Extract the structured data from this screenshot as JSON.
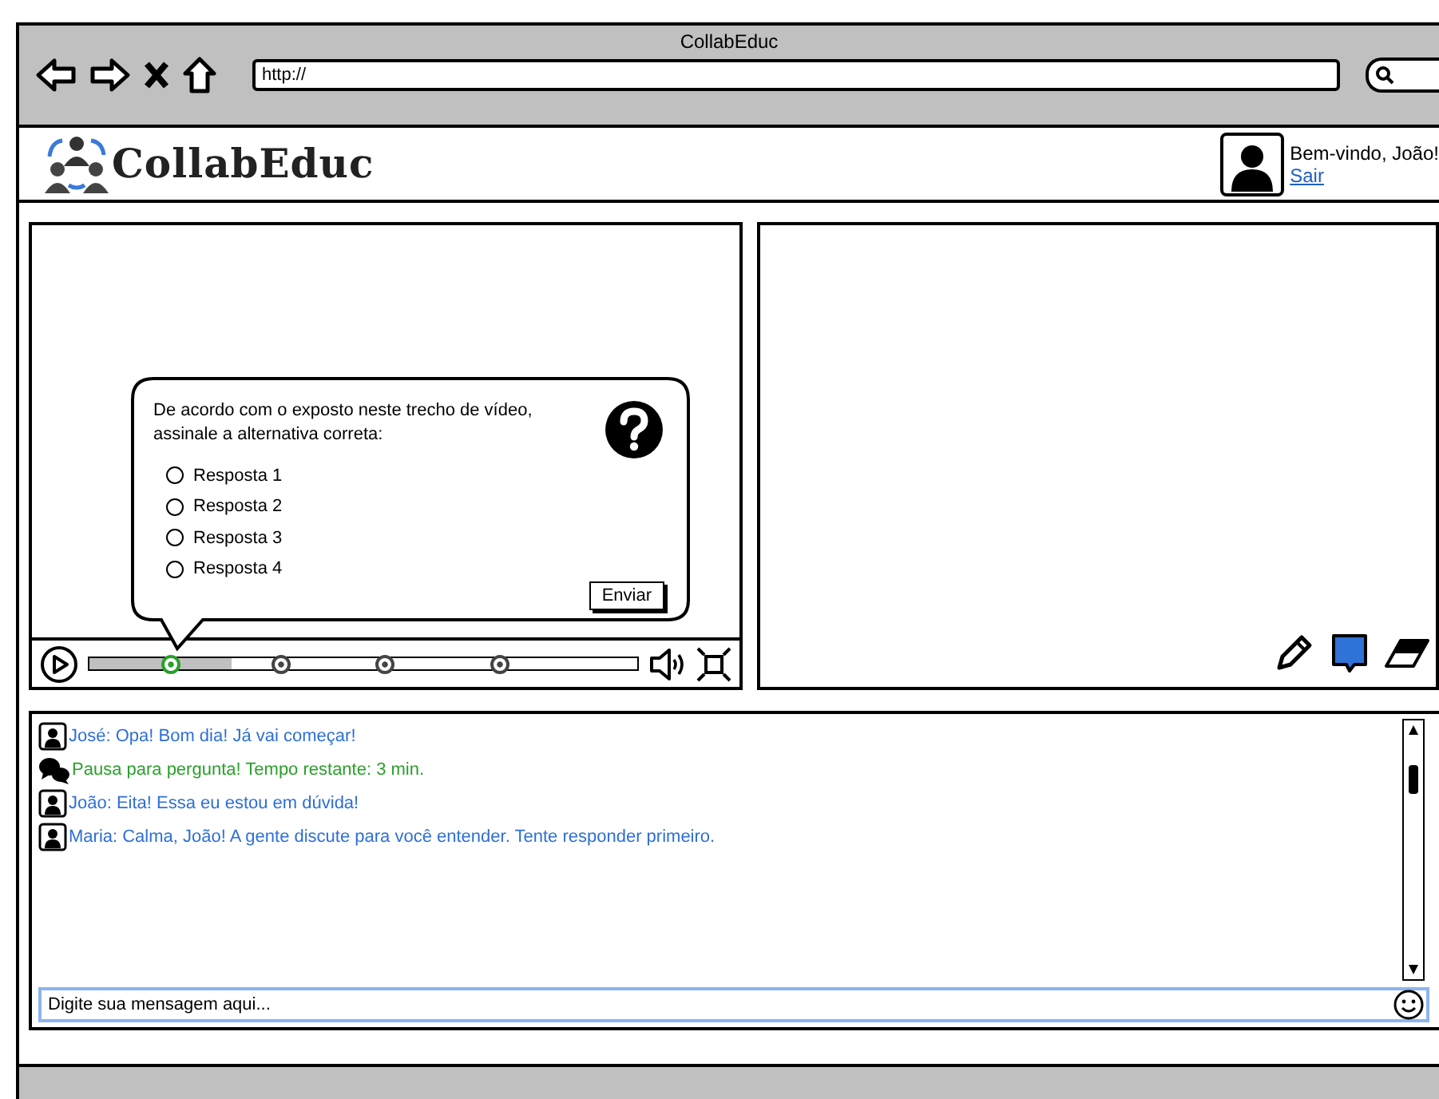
{
  "browser": {
    "title": "CollabEduc",
    "url": "http://"
  },
  "header": {
    "logo": "CollabEduc",
    "greeting": "Bem-vindo, João!",
    "logout": "Sair"
  },
  "video": {
    "progress": {
      "level": 0.26
    },
    "markers": [
      {
        "selected": true
      },
      {
        "selected": false
      },
      {
        "selected": false
      },
      {
        "selected": false
      }
    ],
    "quiz": {
      "question": "De acordo com o exposto neste trecho de vídeo, assinale a alternativa correta:",
      "options": [
        {
          "label": "Resposta 1",
          "selected": false
        },
        {
          "label": "Resposta 2",
          "selected": false
        },
        {
          "label": "Resposta 3",
          "selected": false
        },
        {
          "label": "Resposta 4",
          "selected": false
        }
      ],
      "submit": "Enviar"
    }
  },
  "chat": {
    "messages": [
      {
        "kind": "user",
        "text": "José: Opa! Bom dia! Já vai começar!"
      },
      {
        "kind": "system",
        "text": "Pausa para pergunta! Tempo restante: 3 min."
      },
      {
        "kind": "user",
        "text": "João: Eita! Essa eu estou em dúvida!"
      },
      {
        "kind": "user",
        "text": "Maria: Calma, João! A gente discute para você entender. Tente responder primeiro."
      }
    ],
    "input": {
      "placeholder": "Digite sua mensagem aqui..."
    }
  }
}
